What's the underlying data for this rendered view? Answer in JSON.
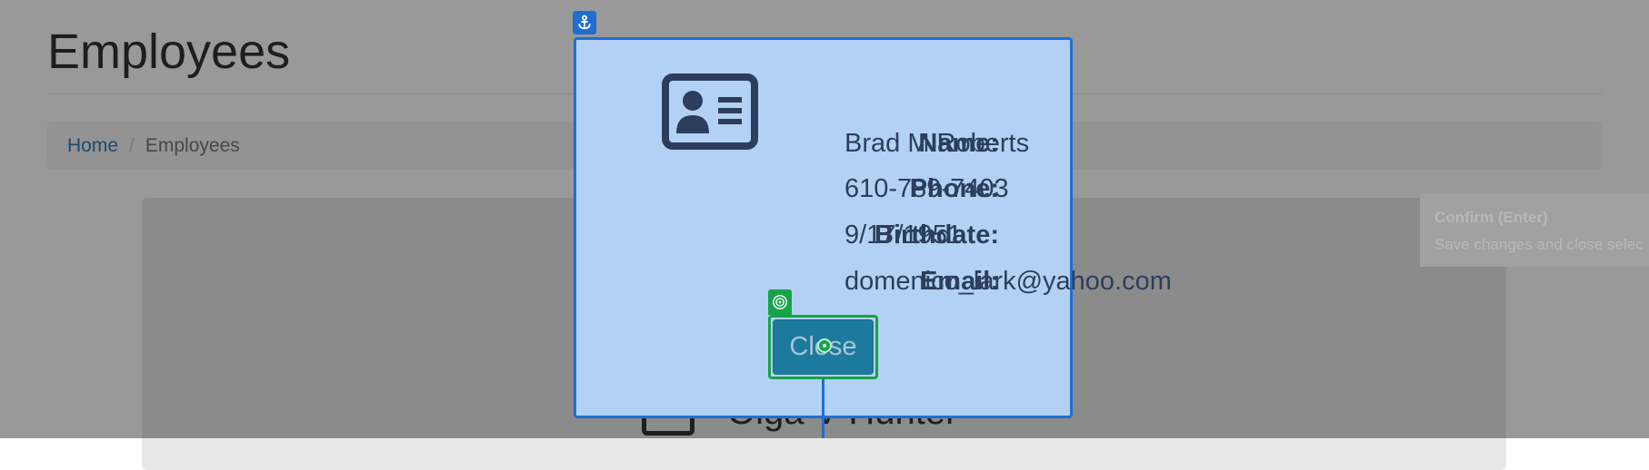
{
  "page": {
    "title": "Employees",
    "breadcrumb": {
      "home": "Home",
      "separator": "/",
      "current": "Employees"
    },
    "background_card_name": "Olga V Hunter"
  },
  "modal": {
    "icon": "id-card-icon",
    "rows": [
      {
        "label": "Name:",
        "value": "Brad M Roberts"
      },
      {
        "label": "Phone:",
        "value": "610-789-7403"
      },
      {
        "label": "Birthdate:",
        "value": "9/17/1951"
      },
      {
        "label": "Email:",
        "value": "domenico_lark@yahoo.com"
      }
    ],
    "close_label": "Close"
  },
  "tooltip": {
    "title": "Confirm (Enter)",
    "text": "Save changes and close selec"
  },
  "colors": {
    "modal_fill": "#b3d1f5",
    "modal_border": "#1f6fd1",
    "target_green": "#16a34a",
    "close_button": "#1c7a9e",
    "link": "#337ab7"
  },
  "icons": {
    "anchor_badge": "anchor-icon",
    "target_badge": "target-icon",
    "cursor": "cursor-dot"
  }
}
